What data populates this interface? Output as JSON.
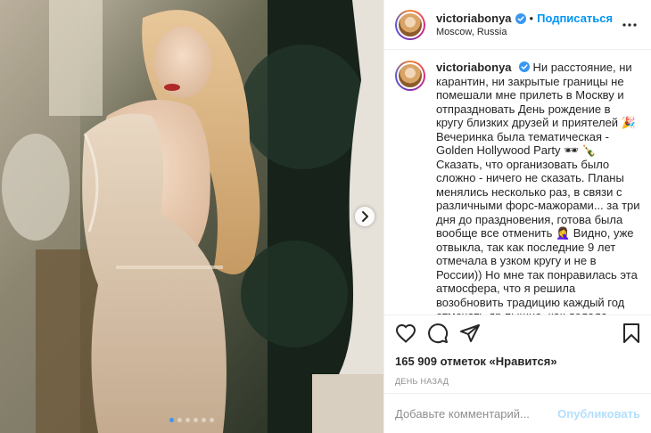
{
  "post": {
    "username": "victoriabonya",
    "follow_label": "Подписаться",
    "separator": "•",
    "location": "Moscow, Russia",
    "more_icon": "more-horizontal-icon",
    "caption": "Ни расстояние, ни карантин, ни закрытые границы не помешали мне прилеть в Москву и отпраздновать День рождение в кругу близких друзей и приятелей 🎉 Вечеринка была тематическая - Golden Hollywood Party 🕶 🍾 Сказать, что организовать было сложно - ничего не сказать. Планы менялись несколько раз, в связи с различными форс-мажорами... за три дня до праздновения, готова была вообще все отменить 🤦‍♀️ Видно, уже отвыкла, так как последние 9 лет отмечала в узком кругу и не в России)) Но мне так понравилась эта атмосфера, что я решила возобновить традицию каждый год отмечать др пышно, как делала раньше 💥 Хочу"
  },
  "actions": {
    "like_icon": "heart-icon",
    "comment_icon": "comment-icon",
    "share_icon": "share-icon",
    "save_icon": "bookmark-icon"
  },
  "likes": {
    "count": "165 909",
    "text": "отметок «Нравится»"
  },
  "date_label": "ДЕНЬ НАЗАД",
  "comment_form": {
    "placeholder": "Добавьте комментарий...",
    "publish_label": "Опубликовать"
  },
  "carousel": {
    "slide_count": 6,
    "active_index": 0,
    "next_icon": "chevron-right-icon"
  },
  "colors": {
    "accent": "#0095f6",
    "publish_disabled": "#b2dffc",
    "carousel_active_dot": "#3897f0",
    "verified_badge": "#3897f0"
  }
}
